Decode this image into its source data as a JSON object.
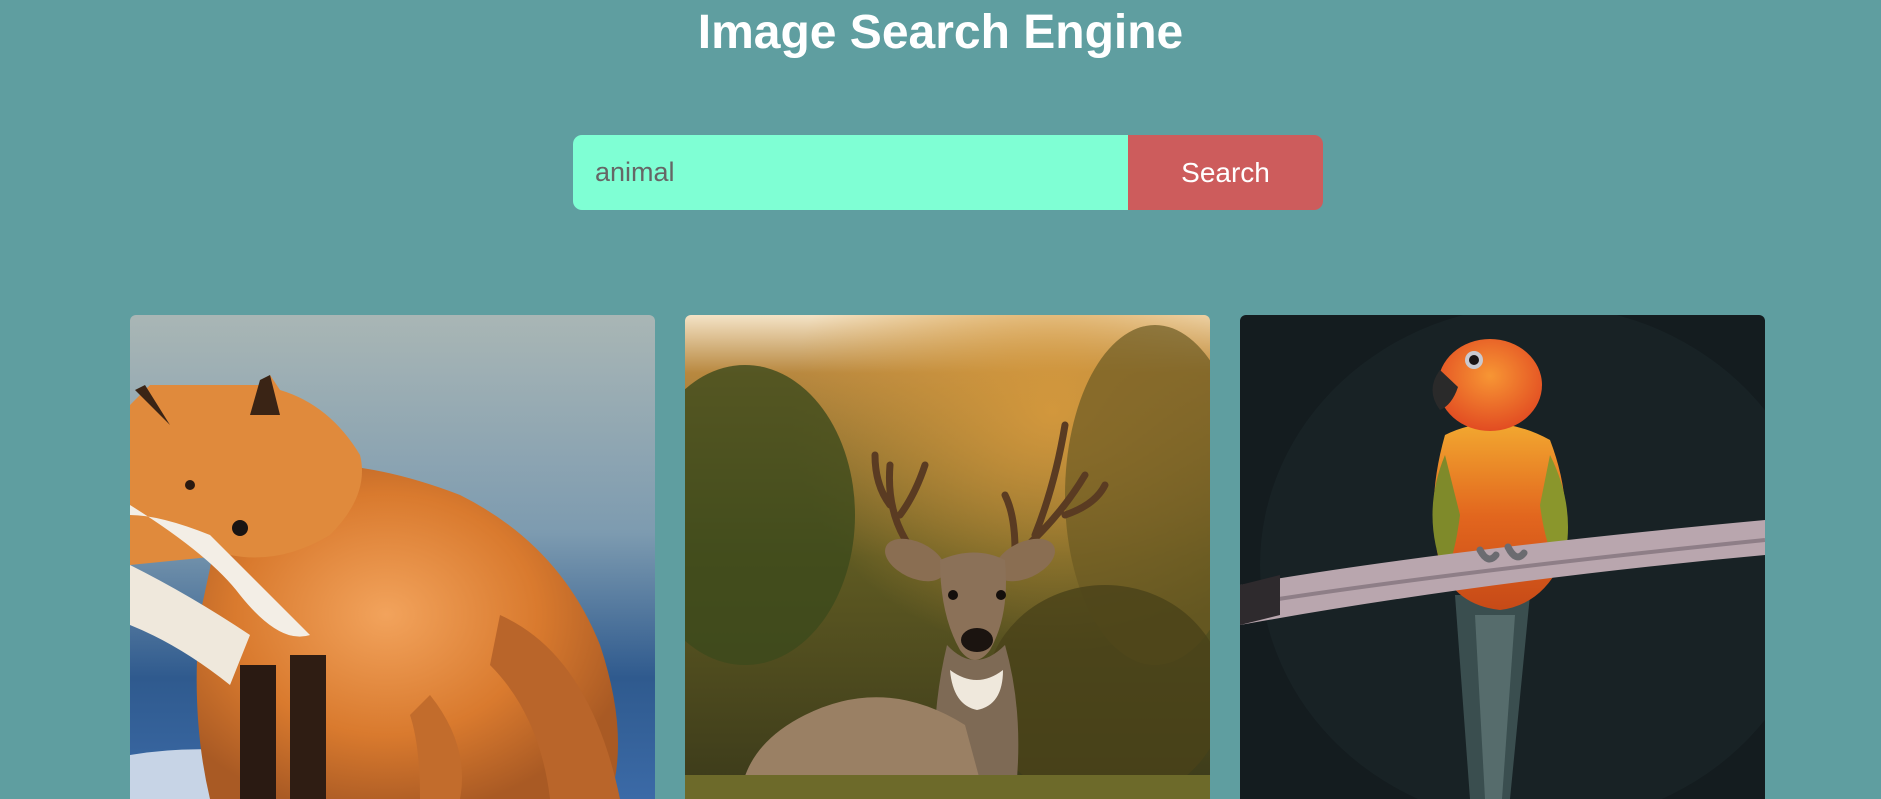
{
  "header": {
    "title": "Image Search Engine"
  },
  "search": {
    "value": "animal",
    "button_label": "Search"
  },
  "colors": {
    "background": "#5f9ea0",
    "input_background": "#7fffd4",
    "button_background": "#cd5c5c",
    "title_text": "#ffffff"
  },
  "results": [
    {
      "subject": "fox"
    },
    {
      "subject": "deer"
    },
    {
      "subject": "parrot"
    }
  ]
}
